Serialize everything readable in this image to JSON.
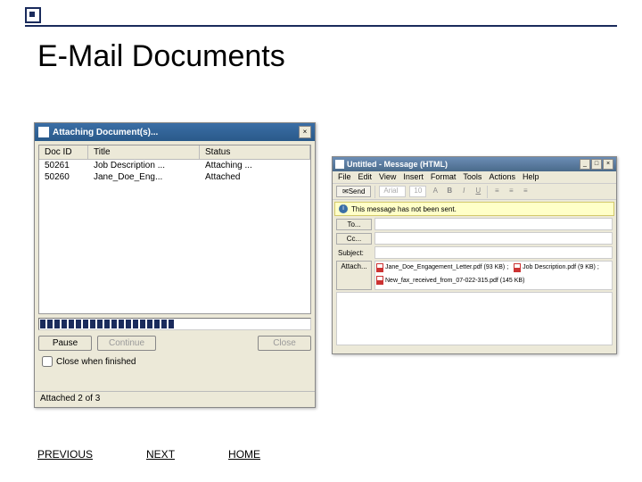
{
  "slide": {
    "title": "E-Mail Documents"
  },
  "attachDialog": {
    "title": "Attaching Document(s)...",
    "columns": [
      "Doc ID",
      "Title",
      "Status"
    ],
    "rows": [
      {
        "id": "50261",
        "title": "Job Description ...",
        "status": "Attaching ..."
      },
      {
        "id": "50260",
        "title": "Jane_Doe_Eng...",
        "status": "Attached"
      }
    ],
    "buttons": {
      "pause": "Pause",
      "continue": "Continue",
      "close": "Close"
    },
    "closeWhenFinished": "Close when finished",
    "status": "Attached 2 of 3"
  },
  "msg": {
    "title": "Untitled - Message (HTML)",
    "menu": [
      "File",
      "Edit",
      "View",
      "Insert",
      "Format",
      "Tools",
      "Actions",
      "Help"
    ],
    "send": "Send",
    "arial": "Arial",
    "size": "10",
    "warn": "This message has not been sent.",
    "to": "To...",
    "cc": "Cc...",
    "subject": "Subject:",
    "attach": "Attach...",
    "attachments": [
      "Jane_Doe_Engagement_Letter.pdf (93 KB)",
      "Job Description.pdf (9 KB)",
      "New_fax_received_from_07-022-315.pdf (145 KB)"
    ]
  },
  "nav": {
    "prev": "PREVIOUS",
    "next": "NEXT",
    "home": "HOME"
  }
}
